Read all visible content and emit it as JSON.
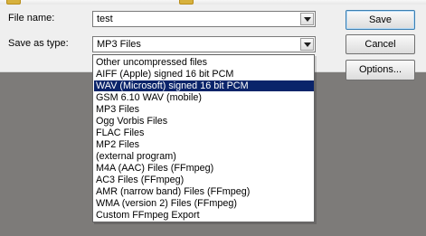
{
  "form": {
    "file_name_label": "File name:",
    "file_name_value": "test",
    "save_as_type_label": "Save as type:",
    "save_as_type_value": "MP3 Files"
  },
  "buttons": {
    "save": "Save",
    "cancel": "Cancel",
    "options": "Options..."
  },
  "dropdown": {
    "selected_index": 2,
    "options": [
      "Other uncompressed files",
      "AIFF (Apple) signed 16 bit PCM",
      "WAV (Microsoft) signed 16 bit PCM",
      "GSM 6.10 WAV (mobile)",
      "MP3 Files",
      "Ogg Vorbis Files",
      "FLAC Files",
      "MP2 Files",
      "(external program)",
      "M4A (AAC) Files (FFmpeg)",
      "AC3 Files (FFmpeg)",
      "AMR (narrow band) Files (FFmpeg)",
      "WMA (version 2) Files (FFmpeg)",
      "Custom FFmpeg Export"
    ]
  },
  "colors": {
    "dialog_background": "#efefef",
    "desktop_background": "#7d7b79",
    "selection": "#0a246a"
  }
}
